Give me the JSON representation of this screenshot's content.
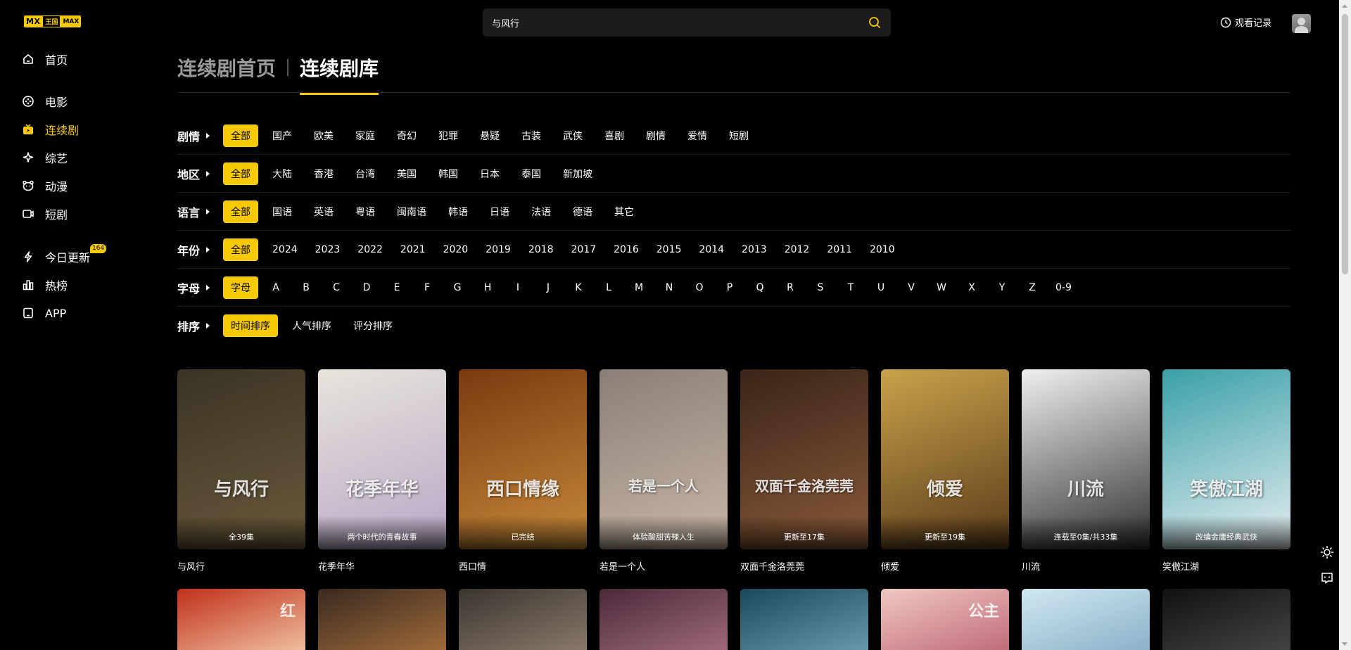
{
  "brand": {
    "logo_mx": "MX",
    "logo_sub": "王国",
    "logo_max": "MAX",
    "accent": "#f7c900"
  },
  "sidebar": {
    "items": [
      {
        "label": "首页",
        "icon": "home-icon"
      },
      {
        "label": "电影",
        "icon": "film-reel-icon"
      },
      {
        "label": "连续剧",
        "icon": "tv-series-icon",
        "active": true
      },
      {
        "label": "综艺",
        "icon": "star-sparkle-icon"
      },
      {
        "label": "动漫",
        "icon": "bear-face-icon"
      },
      {
        "label": "短剧",
        "icon": "short-video-icon"
      },
      {
        "label": "今日更新",
        "icon": "lightning-icon",
        "badge": "164"
      },
      {
        "label": "热榜",
        "icon": "bar-chart-icon"
      },
      {
        "label": "APP",
        "icon": "phone-icon"
      }
    ]
  },
  "header": {
    "search_value": "与风行",
    "history_label": "观看记录"
  },
  "title_tabs": [
    {
      "label": "连续剧首页",
      "active": false
    },
    {
      "label": "连续剧库",
      "active": true
    }
  ],
  "filters": [
    {
      "label": "剧情",
      "options": [
        "全部",
        "国产",
        "欧美",
        "家庭",
        "奇幻",
        "犯罪",
        "悬疑",
        "古装",
        "武侠",
        "喜剧",
        "剧情",
        "爱情",
        "短剧"
      ],
      "selected": 0
    },
    {
      "label": "地区",
      "options": [
        "全部",
        "大陆",
        "香港",
        "台湾",
        "美国",
        "韩国",
        "日本",
        "泰国",
        "新加坡"
      ],
      "selected": 0
    },
    {
      "label": "语言",
      "options": [
        "全部",
        "国语",
        "英语",
        "粤语",
        "闽南语",
        "韩语",
        "日语",
        "法语",
        "德语",
        "其它"
      ],
      "selected": 0
    },
    {
      "label": "年份",
      "options": [
        "全部",
        "2024",
        "2023",
        "2022",
        "2021",
        "2020",
        "2019",
        "2018",
        "2017",
        "2016",
        "2015",
        "2014",
        "2013",
        "2012",
        "2011",
        "2010"
      ],
      "selected": 0
    },
    {
      "label": "字母",
      "options": [
        "字母",
        "A",
        "B",
        "C",
        "D",
        "E",
        "F",
        "G",
        "H",
        "I",
        "J",
        "K",
        "L",
        "M",
        "N",
        "O",
        "P",
        "Q",
        "R",
        "S",
        "T",
        "U",
        "V",
        "W",
        "X",
        "Y",
        "Z",
        "0-9"
      ],
      "selected": 0
    },
    {
      "label": "排序",
      "options": [
        "时间排序",
        "人气排序",
        "评分排序"
      ],
      "selected": 0
    }
  ],
  "shows": [
    {
      "title": "与风行",
      "caption": "全39集",
      "art": "与风行",
      "c1": "#3a3325",
      "c2": "#6b5a3a"
    },
    {
      "title": "花季年华",
      "caption": "两个时代的青春故事",
      "art": "花季年华",
      "c1": "#e8e4dc",
      "c2": "#b8a7c6"
    },
    {
      "title": "西口情",
      "caption": "已完结",
      "art": "西口情缘",
      "c1": "#7a3a10",
      "c2": "#c78a3a"
    },
    {
      "title": "若是一个人",
      "caption": "体验酸甜苦辣人生",
      "art": "若是一个人",
      "c1": "#8a7f78",
      "c2": "#c9b7a6"
    },
    {
      "title": "双面千金洛莞莞",
      "caption": "更新至17集",
      "art": "双面千金洛莞莞",
      "c1": "#3a2418",
      "c2": "#8a5a3a"
    },
    {
      "title": "倾爱",
      "caption": "更新至19集",
      "art": "倾爱",
      "c1": "#c9a24a",
      "c2": "#5a3a1a"
    },
    {
      "title": "川流",
      "caption": "连载至0集/共33集",
      "art": "川流",
      "c1": "#f0f0f0",
      "c2": "#303030"
    },
    {
      "title": "笑傲江湖",
      "caption": "改编金庸经典武侠",
      "art": "笑傲江湖",
      "c1": "#3aa0a8",
      "c2": "#e6eef0"
    }
  ],
  "shows_row2": [
    {
      "c1": "#c0301a",
      "c2": "#f0c0a0",
      "art": "红"
    },
    {
      "c1": "#3a2a20",
      "c2": "#a06a3a",
      "art": ""
    },
    {
      "c1": "#3a3530",
      "c2": "#8a7a6a",
      "art": ""
    },
    {
      "c1": "#4a2a3a",
      "c2": "#a06a7a",
      "art": ""
    },
    {
      "c1": "#1a4a5a",
      "c2": "#6a9aaa",
      "art": ""
    },
    {
      "c1": "#f0c8c0",
      "c2": "#c06a7a",
      "art": "公主"
    },
    {
      "c1": "#d0e8f0",
      "c2": "#8ab0c8",
      "art": ""
    },
    {
      "c1": "#111111",
      "c2": "#444444",
      "art": ""
    }
  ]
}
